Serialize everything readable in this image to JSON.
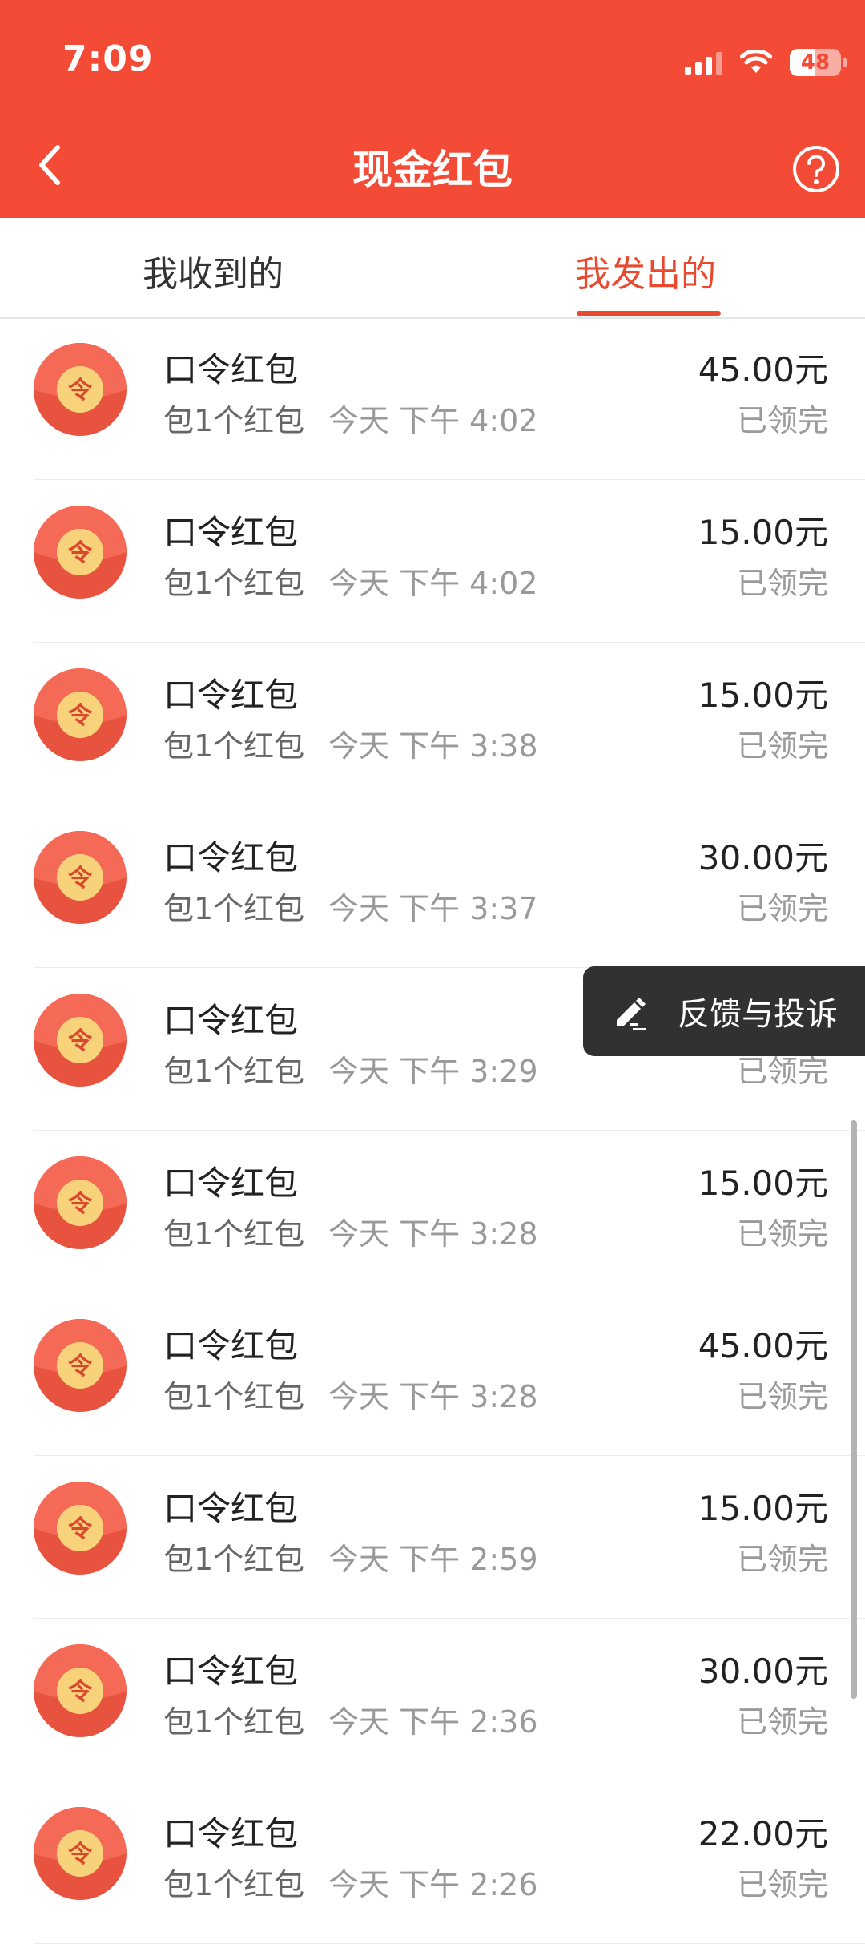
{
  "status_bar": {
    "time": "7:09",
    "battery": "48",
    "battery_level": 0.48
  },
  "header": {
    "title": "现金红包"
  },
  "tabs": [
    {
      "label": "我收到的",
      "active": false
    },
    {
      "label": "我发出的",
      "active": true
    }
  ],
  "colors": {
    "brand": "#f34b36",
    "accent": "#e8492f",
    "envelope": "#e8533f",
    "seal": "#f7d27a"
  },
  "icons": {
    "back": "chevron-left-icon",
    "help": "question-circle-icon",
    "feedback": "edit-pen-icon"
  },
  "records": [
    {
      "title": "口令红包",
      "count": "包1个红包",
      "time": "今天 下午 4:02",
      "amount": "45.00元",
      "status": "已领完"
    },
    {
      "title": "口令红包",
      "count": "包1个红包",
      "time": "今天 下午 4:02",
      "amount": "15.00元",
      "status": "已领完"
    },
    {
      "title": "口令红包",
      "count": "包1个红包",
      "time": "今天 下午 3:38",
      "amount": "15.00元",
      "status": "已领完"
    },
    {
      "title": "口令红包",
      "count": "包1个红包",
      "time": "今天 下午 3:37",
      "amount": "30.00元",
      "status": "已领完"
    },
    {
      "title": "口令红包",
      "count": "包1个红包",
      "time": "今天 下午 3:29",
      "amount": "",
      "status": "已领完"
    },
    {
      "title": "口令红包",
      "count": "包1个红包",
      "time": "今天 下午 3:28",
      "amount": "15.00元",
      "status": "已领完"
    },
    {
      "title": "口令红包",
      "count": "包1个红包",
      "time": "今天 下午 3:28",
      "amount": "45.00元",
      "status": "已领完"
    },
    {
      "title": "口令红包",
      "count": "包1个红包",
      "time": "今天 下午 2:59",
      "amount": "15.00元",
      "status": "已领完"
    },
    {
      "title": "口令红包",
      "count": "包1个红包",
      "time": "今天 下午 2:36",
      "amount": "30.00元",
      "status": "已领完"
    },
    {
      "title": "口令红包",
      "count": "包1个红包",
      "time": "今天 下午 2:26",
      "amount": "22.00元",
      "status": "已领完"
    }
  ],
  "envelope_glyph": "令",
  "feedback": {
    "label": "反馈与投诉"
  }
}
